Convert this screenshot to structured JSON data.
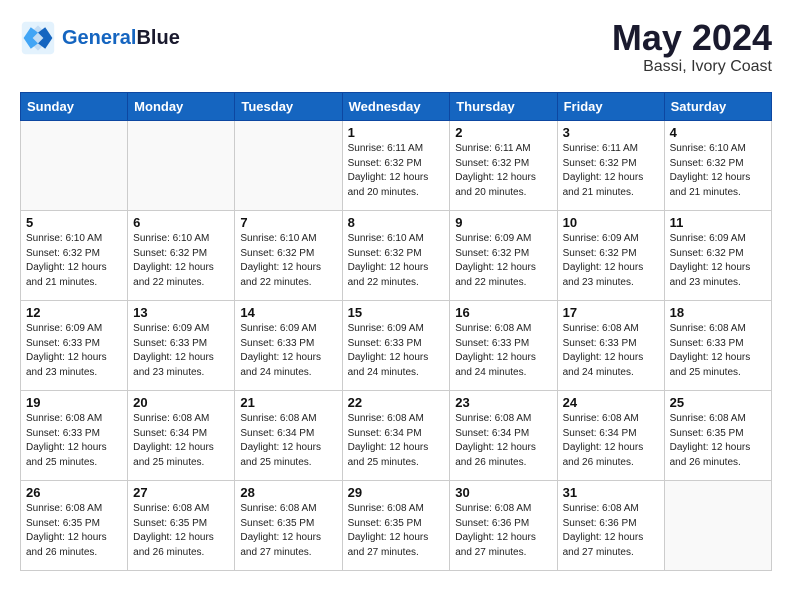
{
  "header": {
    "logo_line1": "General",
    "logo_line2": "Blue",
    "month": "May 2024",
    "location": "Bassi, Ivory Coast"
  },
  "weekdays": [
    "Sunday",
    "Monday",
    "Tuesday",
    "Wednesday",
    "Thursday",
    "Friday",
    "Saturday"
  ],
  "weeks": [
    [
      {
        "day": "",
        "detail": ""
      },
      {
        "day": "",
        "detail": ""
      },
      {
        "day": "",
        "detail": ""
      },
      {
        "day": "1",
        "detail": "Sunrise: 6:11 AM\nSunset: 6:32 PM\nDaylight: 12 hours\nand 20 minutes."
      },
      {
        "day": "2",
        "detail": "Sunrise: 6:11 AM\nSunset: 6:32 PM\nDaylight: 12 hours\nand 20 minutes."
      },
      {
        "day": "3",
        "detail": "Sunrise: 6:11 AM\nSunset: 6:32 PM\nDaylight: 12 hours\nand 21 minutes."
      },
      {
        "day": "4",
        "detail": "Sunrise: 6:10 AM\nSunset: 6:32 PM\nDaylight: 12 hours\nand 21 minutes."
      }
    ],
    [
      {
        "day": "5",
        "detail": "Sunrise: 6:10 AM\nSunset: 6:32 PM\nDaylight: 12 hours\nand 21 minutes."
      },
      {
        "day": "6",
        "detail": "Sunrise: 6:10 AM\nSunset: 6:32 PM\nDaylight: 12 hours\nand 22 minutes."
      },
      {
        "day": "7",
        "detail": "Sunrise: 6:10 AM\nSunset: 6:32 PM\nDaylight: 12 hours\nand 22 minutes."
      },
      {
        "day": "8",
        "detail": "Sunrise: 6:10 AM\nSunset: 6:32 PM\nDaylight: 12 hours\nand 22 minutes."
      },
      {
        "day": "9",
        "detail": "Sunrise: 6:09 AM\nSunset: 6:32 PM\nDaylight: 12 hours\nand 22 minutes."
      },
      {
        "day": "10",
        "detail": "Sunrise: 6:09 AM\nSunset: 6:32 PM\nDaylight: 12 hours\nand 23 minutes."
      },
      {
        "day": "11",
        "detail": "Sunrise: 6:09 AM\nSunset: 6:32 PM\nDaylight: 12 hours\nand 23 minutes."
      }
    ],
    [
      {
        "day": "12",
        "detail": "Sunrise: 6:09 AM\nSunset: 6:33 PM\nDaylight: 12 hours\nand 23 minutes."
      },
      {
        "day": "13",
        "detail": "Sunrise: 6:09 AM\nSunset: 6:33 PM\nDaylight: 12 hours\nand 23 minutes."
      },
      {
        "day": "14",
        "detail": "Sunrise: 6:09 AM\nSunset: 6:33 PM\nDaylight: 12 hours\nand 24 minutes."
      },
      {
        "day": "15",
        "detail": "Sunrise: 6:09 AM\nSunset: 6:33 PM\nDaylight: 12 hours\nand 24 minutes."
      },
      {
        "day": "16",
        "detail": "Sunrise: 6:08 AM\nSunset: 6:33 PM\nDaylight: 12 hours\nand 24 minutes."
      },
      {
        "day": "17",
        "detail": "Sunrise: 6:08 AM\nSunset: 6:33 PM\nDaylight: 12 hours\nand 24 minutes."
      },
      {
        "day": "18",
        "detail": "Sunrise: 6:08 AM\nSunset: 6:33 PM\nDaylight: 12 hours\nand 25 minutes."
      }
    ],
    [
      {
        "day": "19",
        "detail": "Sunrise: 6:08 AM\nSunset: 6:33 PM\nDaylight: 12 hours\nand 25 minutes."
      },
      {
        "day": "20",
        "detail": "Sunrise: 6:08 AM\nSunset: 6:34 PM\nDaylight: 12 hours\nand 25 minutes."
      },
      {
        "day": "21",
        "detail": "Sunrise: 6:08 AM\nSunset: 6:34 PM\nDaylight: 12 hours\nand 25 minutes."
      },
      {
        "day": "22",
        "detail": "Sunrise: 6:08 AM\nSunset: 6:34 PM\nDaylight: 12 hours\nand 25 minutes."
      },
      {
        "day": "23",
        "detail": "Sunrise: 6:08 AM\nSunset: 6:34 PM\nDaylight: 12 hours\nand 26 minutes."
      },
      {
        "day": "24",
        "detail": "Sunrise: 6:08 AM\nSunset: 6:34 PM\nDaylight: 12 hours\nand 26 minutes."
      },
      {
        "day": "25",
        "detail": "Sunrise: 6:08 AM\nSunset: 6:35 PM\nDaylight: 12 hours\nand 26 minutes."
      }
    ],
    [
      {
        "day": "26",
        "detail": "Sunrise: 6:08 AM\nSunset: 6:35 PM\nDaylight: 12 hours\nand 26 minutes."
      },
      {
        "day": "27",
        "detail": "Sunrise: 6:08 AM\nSunset: 6:35 PM\nDaylight: 12 hours\nand 26 minutes."
      },
      {
        "day": "28",
        "detail": "Sunrise: 6:08 AM\nSunset: 6:35 PM\nDaylight: 12 hours\nand 27 minutes."
      },
      {
        "day": "29",
        "detail": "Sunrise: 6:08 AM\nSunset: 6:35 PM\nDaylight: 12 hours\nand 27 minutes."
      },
      {
        "day": "30",
        "detail": "Sunrise: 6:08 AM\nSunset: 6:36 PM\nDaylight: 12 hours\nand 27 minutes."
      },
      {
        "day": "31",
        "detail": "Sunrise: 6:08 AM\nSunset: 6:36 PM\nDaylight: 12 hours\nand 27 minutes."
      },
      {
        "day": "",
        "detail": ""
      }
    ]
  ]
}
